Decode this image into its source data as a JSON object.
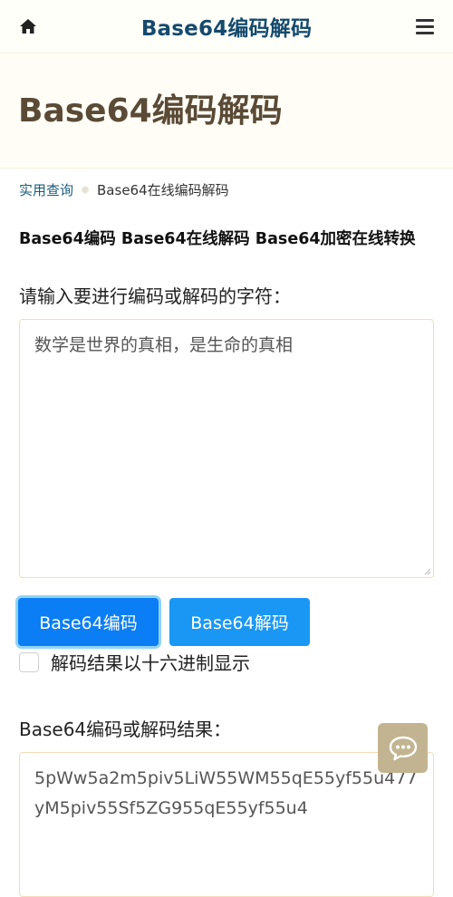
{
  "header": {
    "title": "Base64编码解码",
    "home_icon": "home-icon",
    "menu_icon": "hamburger-menu-icon"
  },
  "hero": {
    "title": "Base64编码解码"
  },
  "breadcrumb": {
    "parent": "实用查询",
    "current": "Base64在线编码解码"
  },
  "tagline": "Base64编码 Base64在线解码 Base64加密在线转换",
  "input_section": {
    "label": "请输入要进行编码或解码的字符：",
    "value": "数学是世界的真相，是生命的真相"
  },
  "actions": {
    "encode_label": "Base64编码",
    "decode_label": "Base64解码",
    "hex_checkbox_label": "解码结果以十六进制显示",
    "hex_checked": false
  },
  "output_section": {
    "label": "Base64编码或解码结果：",
    "value": "5pWw5a2m5piv5LiW55WM55qE55yf55u477yM5piv55Sf5ZG955qE55yf55u4"
  },
  "chat_fab": {
    "icon": "chat-bubble-icon"
  },
  "colors": {
    "brand_title": "#154a6e",
    "hero_title": "#5a4a36",
    "primary_button": "#0b7ef5",
    "secondary_button": "#1a97f5",
    "chat_button": "#c2b490"
  }
}
